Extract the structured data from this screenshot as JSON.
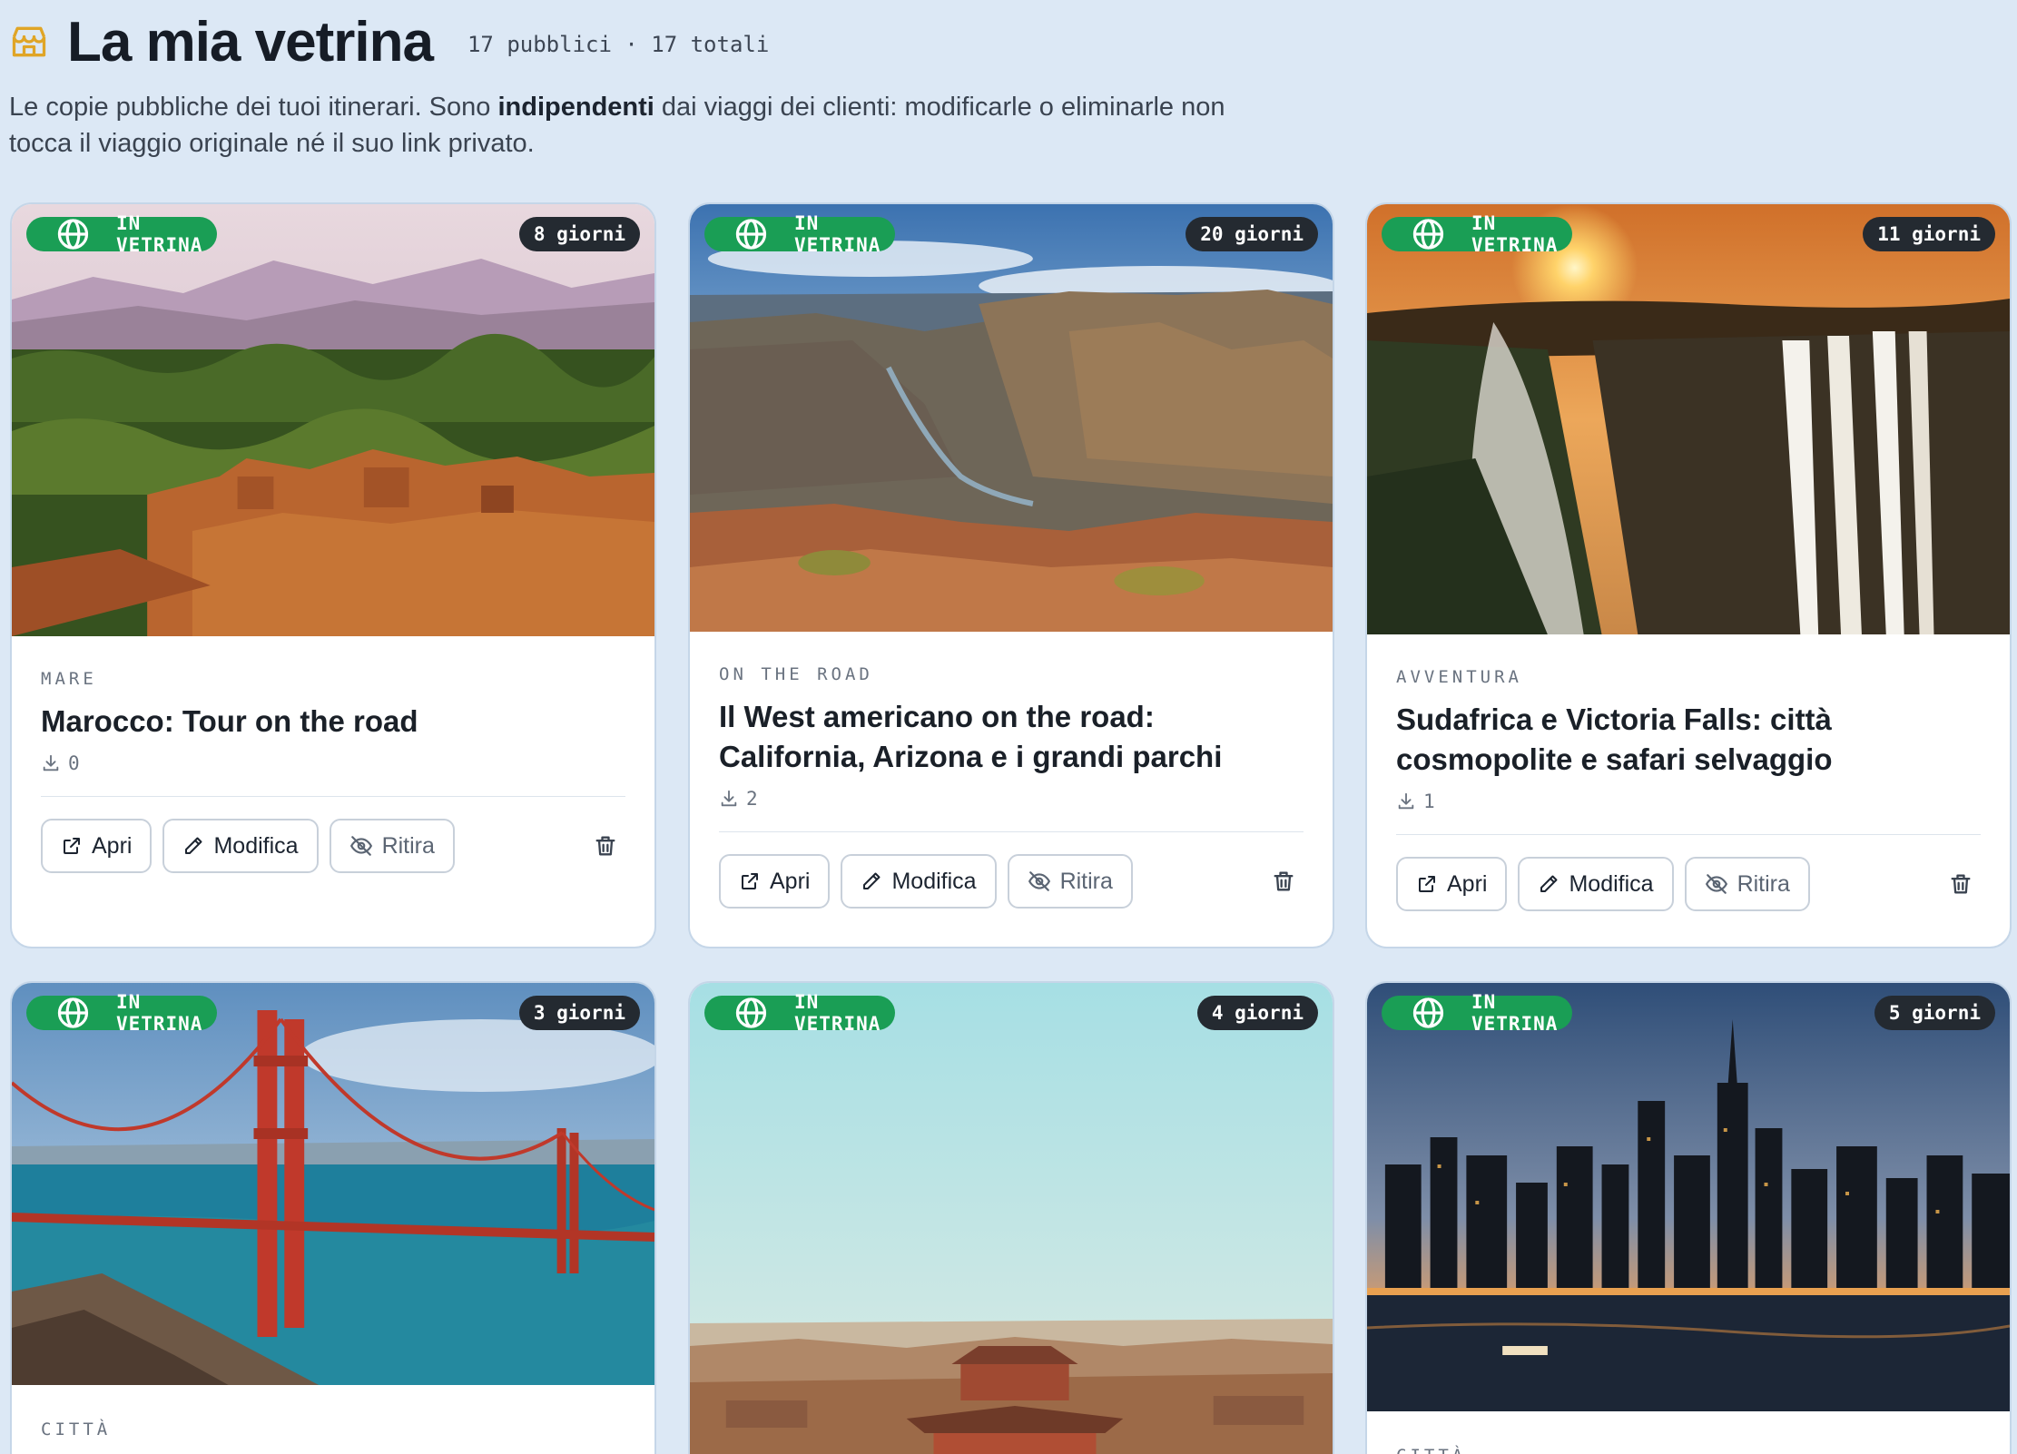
{
  "header": {
    "title": "La mia vetrina",
    "counts": "17 pubblici · 17 totali",
    "subtitle_before": "Le copie pubbliche dei tuoi itinerari. Sono ",
    "subtitle_bold": "indipendenti",
    "subtitle_after": " dai viaggi dei clienti: modificarle o eliminarle non tocca il viaggio originale né il suo link privato."
  },
  "labels": {
    "live_badge": "IN VETRINA",
    "open": "Apri",
    "edit": "Modifica",
    "retire": "Ritira"
  },
  "cards": [
    {
      "days": "8 giorni",
      "category": "MARE",
      "title": "Marocco: Tour on the road",
      "downloads": "0"
    },
    {
      "days": "20 giorni",
      "category": "ON THE ROAD",
      "title": "Il West americano on the road: California, Arizona e i grandi parchi",
      "downloads": "2"
    },
    {
      "days": "11 giorni",
      "category": "AVVENTURA",
      "title": "Sudafrica e Victoria Falls: città cosmopolite e safari selvaggio",
      "downloads": "1"
    },
    {
      "days": "3 giorni",
      "category": "CITTÀ",
      "title": "",
      "downloads": ""
    },
    {
      "days": "4 giorni",
      "category": "",
      "title": "",
      "downloads": ""
    },
    {
      "days": "5 giorni",
      "category": "CITTÀ",
      "title": "",
      "downloads": ""
    }
  ],
  "colors": {
    "page_bg": "#dce8f5",
    "live_badge": "#1a9e55",
    "days_badge": "#242a31",
    "store_icon": "#e0a526"
  }
}
